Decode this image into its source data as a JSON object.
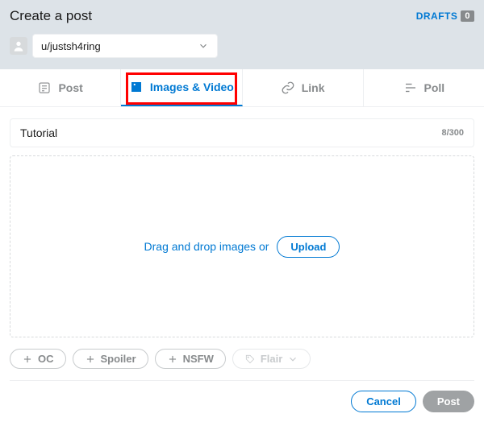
{
  "header": {
    "title": "Create a post",
    "drafts_label": "DRAFTS",
    "drafts_count": "0",
    "community": "u/justsh4ring"
  },
  "tabs": {
    "post": "Post",
    "images_video": "Images & Video",
    "link": "Link",
    "poll": "Poll"
  },
  "title_field": {
    "value": "Tutorial",
    "counter": "8/300"
  },
  "dropzone": {
    "text": "Drag and drop images or",
    "upload": "Upload"
  },
  "tags": {
    "oc": "OC",
    "spoiler": "Spoiler",
    "nsfw": "NSFW",
    "flair": "Flair"
  },
  "footer": {
    "cancel": "Cancel",
    "post": "Post"
  }
}
